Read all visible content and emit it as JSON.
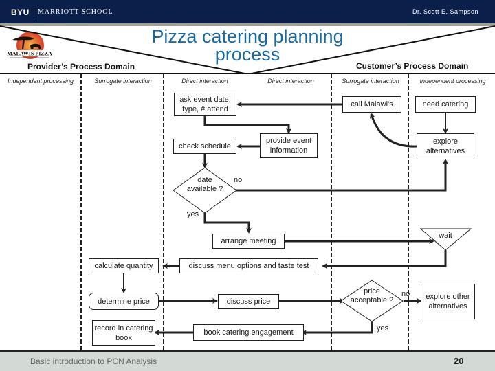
{
  "header": {
    "brand": "BYU",
    "school": "MARRIOTT SCHOOL",
    "author": "Dr. Scott E. Sampson"
  },
  "logo": {
    "text": "MALAWIS PIZZA"
  },
  "title": "Pizza catering planning process",
  "domains": {
    "provider": "Provider’s Process Domain",
    "customer": "Customer’s Process Domain"
  },
  "lanes": [
    {
      "label": "Independent processing"
    },
    {
      "label": "Surrogate interaction"
    },
    {
      "label": "Direct interaction"
    },
    {
      "label": "Direct interaction"
    },
    {
      "label": "Surrogate interaction"
    },
    {
      "label": "Independent processing"
    }
  ],
  "nodes": {
    "need_catering": "need catering",
    "call_malawis": "call Malawi’s",
    "explore_alternatives": "explore alternatives",
    "ask_event": "ask event date, type, # attend",
    "provide_event_info": "provide event information",
    "check_schedule": "check schedule",
    "date_available": "date available ?",
    "arrange_meeting": "arrange meeting",
    "wait": "wait",
    "discuss_menu": "discuss menu options and taste test",
    "calculate_quantity": "calculate quantity",
    "determine_price": "determine price",
    "discuss_price": "discuss price",
    "price_acceptable": "price acceptable ?",
    "explore_other_alternatives": "explore other alternatives",
    "book_catering": "book catering engagement",
    "record_catering": "record in catering book"
  },
  "decision_labels": {
    "date_no": "no",
    "date_yes": "yes",
    "price_no": "no",
    "price_yes": "yes"
  },
  "footer": {
    "text": "Basic introduction to PCN Analysis",
    "page": "20"
  },
  "colors": {
    "header_bg": "#0b1f4b",
    "title": "#1a6aa0",
    "footer_bg": "#d3d9d5"
  }
}
